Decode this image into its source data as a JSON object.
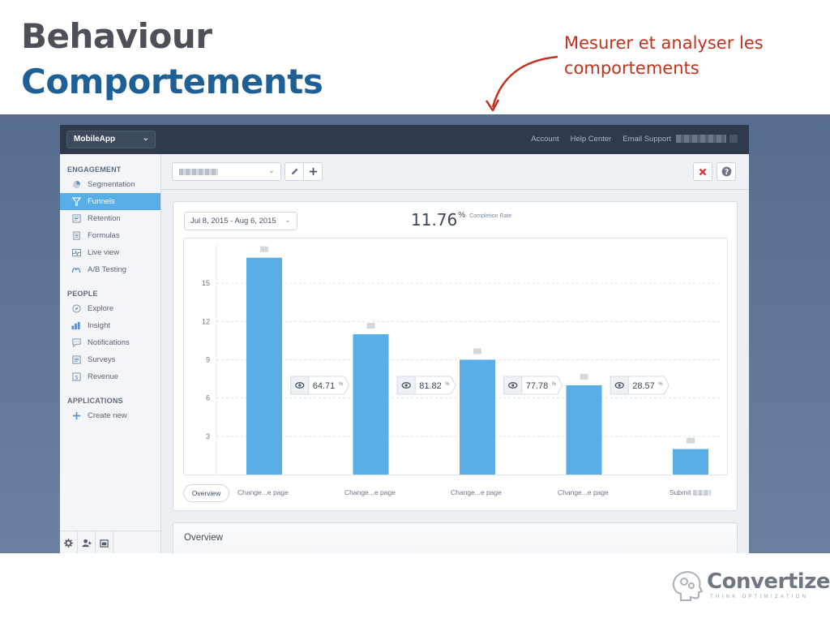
{
  "slide": {
    "title_line1": "Behaviour",
    "title_line2": "Comportements",
    "annotation": "Mesurer et analyser les comportements",
    "colors": {
      "title_grey": "#4d5058",
      "title_blue": "#1e5f96",
      "annotation_red": "#c0321e"
    }
  },
  "app": {
    "project_selector": "MobileApp",
    "top_links": [
      "Account",
      "Help Center",
      "Email Support"
    ],
    "sidebar": {
      "sections": [
        {
          "heading": "ENGAGEMENT",
          "items": [
            {
              "label": "Segmentation",
              "icon": "pie-chart-icon",
              "active": false
            },
            {
              "label": "Funnels",
              "icon": "funnel-icon",
              "active": true
            },
            {
              "label": "Retention",
              "icon": "retention-grid-icon",
              "active": false
            },
            {
              "label": "Formulas",
              "icon": "formula-icon",
              "active": false
            },
            {
              "label": "Live view",
              "icon": "live-pulse-icon",
              "active": false
            },
            {
              "label": "A/B Testing",
              "icon": "ab-test-icon",
              "active": false
            }
          ]
        },
        {
          "heading": "PEOPLE",
          "items": [
            {
              "label": "Explore",
              "icon": "compass-icon",
              "active": false
            },
            {
              "label": "Insight",
              "icon": "insight-bars-icon",
              "active": false
            },
            {
              "label": "Notifications",
              "icon": "chat-bubble-icon",
              "active": false
            },
            {
              "label": "Surveys",
              "icon": "survey-icon",
              "active": false
            },
            {
              "label": "Revenue",
              "icon": "dollar-icon",
              "active": false
            }
          ]
        },
        {
          "heading": "APPLICATIONS",
          "items": [
            {
              "label": "Create new",
              "icon": "plus-icon",
              "active": false
            }
          ]
        }
      ]
    },
    "report": {
      "date_range": "Jul 8, 2015 - Aug 6, 2015",
      "completion_value": "11.76",
      "completion_unit": "%",
      "completion_label": "Completion Rate",
      "overview_tab": "Overview",
      "overview_section_title": "Overview"
    }
  },
  "chart_data": {
    "type": "bar",
    "categories": [
      "Change...e page",
      "Change...e page",
      "Change...e page",
      "Change...e page",
      "Submit"
    ],
    "values": [
      17,
      11,
      9,
      7,
      2
    ],
    "ylim": [
      0,
      18
    ],
    "yticks": [
      3,
      6,
      9,
      12,
      15
    ],
    "conversion_rates": [
      "64.71",
      "81.82",
      "77.78",
      "28.57"
    ],
    "conversion_unit": "%",
    "grid": true,
    "bar_color": "#5aaee6"
  },
  "brand": {
    "name": "Convertize",
    "tagline": "THINK OPTIMIZATION"
  }
}
